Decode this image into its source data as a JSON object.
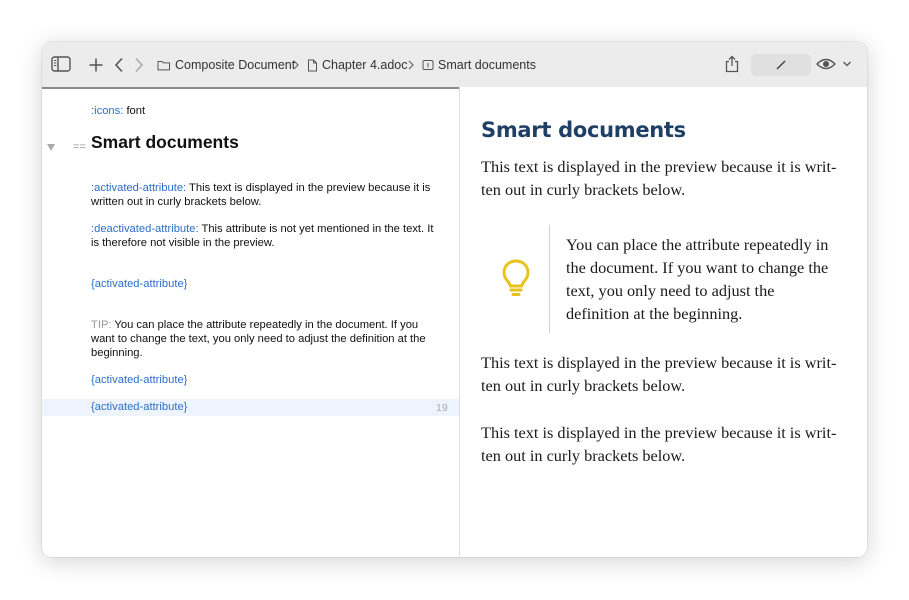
{
  "toolbar": {
    "breadcrumbs": [
      {
        "label": "Composite Document",
        "icon": "folder-icon"
      },
      {
        "label": "Chapter 4.adoc",
        "icon": "document-icon"
      },
      {
        "label": "Smart documents",
        "icon": "section-icon"
      }
    ]
  },
  "editor": {
    "icons_attr": ":icons:",
    "icons_value": " font",
    "heading_marker": "==",
    "heading": "Smart documents",
    "activated_attr": ":activated-attribute:",
    "activated_text": " This text is displayed in the preview because it is written out in curly brackets below.",
    "deactivated_attr": ":deactivated-attribute:",
    "deactivated_text": " This attribute is not yet mentioned in the text. It is therefore not visible in the preview.",
    "ref1": "{activated-attribute}",
    "tip_label": "TIP:",
    "tip_text": " You can place the attribute repeatedly in the document. If you want to change the text, you only need to adjust the definition at the beginning.",
    "ref2": "{activated-attribute}",
    "ref3": "{activated-attribute}",
    "current_line_number": "19"
  },
  "preview": {
    "title": "Smart documents",
    "para1": "This text is displayed in the preview because it is writ-ten out in curly brackets below.",
    "tip": "You can place the attribute repeatedly in the document. If you want to change the text, you only need to adjust the definition at the beginning.",
    "para2": "This text is displayed in the preview because it is writ-ten out in curly brackets below.",
    "para3": "This text is displayed in the preview because it is writ-ten out in curly brackets below."
  },
  "colors": {
    "attribute": "#2b6fc7",
    "preview_title": "#1f3f66",
    "tip_icon": "#e8c21a"
  }
}
